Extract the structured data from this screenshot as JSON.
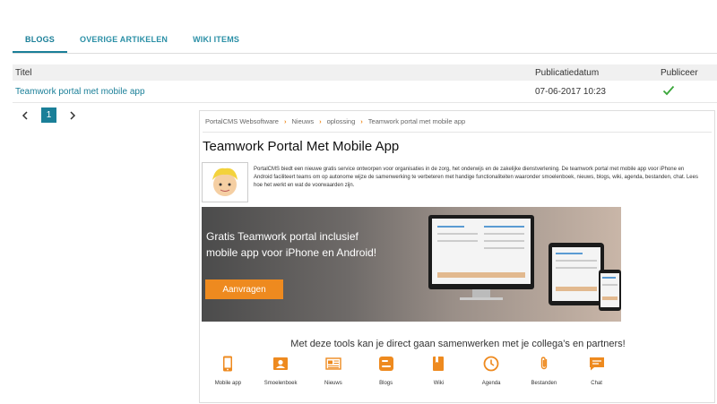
{
  "tabs": [
    "BLOGS",
    "OVERIGE ARTIKELEN",
    "WIKI ITEMS"
  ],
  "table": {
    "headers": {
      "title": "Titel",
      "date": "Publicatiedatum",
      "publish": "Publiceer"
    },
    "rows": [
      {
        "title": "Teamwork portal met mobile app",
        "date": "07-06-2017 10:23",
        "published": true
      }
    ]
  },
  "pagination": {
    "current": "1"
  },
  "preview": {
    "breadcrumbs": [
      "PortalCMS Websoftware",
      "Nieuws",
      "oplossing",
      "Teamwork portal met mobile app"
    ],
    "title": "Teamwork Portal Met Mobile App",
    "intro": "PortalCMS biedt een nieuwe gratis service ontworpen voor organisaties in de zorg, het onderwijs en de zakelijke dienstverlening. De teamwork portal met mobile app voor iPhone en Android faciliteert teams om op autonome wijze de samenwerking te verbeteren met handige functionaliteiten waaronder smoelenboek, nieuws, blogs, wiki, agenda, bestanden, chat. Lees hoe het werkt en wat de voorwaarden zijn.",
    "banner": {
      "line1": "Gratis Teamwork portal inclusief",
      "line2": "mobile app voor iPhone en Android!",
      "button": "Aanvragen"
    },
    "tagline": "Met deze tools kan je direct gaan samenwerken met je collega’s en partners!",
    "tools": [
      {
        "label": "Mobile app",
        "icon": "phone-icon"
      },
      {
        "label": "Smoelenboek",
        "icon": "contact-card-icon"
      },
      {
        "label": "Nieuws",
        "icon": "newspaper-icon"
      },
      {
        "label": "Blogs",
        "icon": "blogger-icon"
      },
      {
        "label": "Wiki",
        "icon": "book-icon"
      },
      {
        "label": "Agenda",
        "icon": "clock-icon"
      },
      {
        "label": "Bestanden",
        "icon": "paperclip-icon"
      },
      {
        "label": "Chat",
        "icon": "chat-icon"
      }
    ]
  },
  "colors": {
    "accent": "#1a7f98",
    "orange": "#ee8a1f",
    "check": "#3aa63a"
  }
}
